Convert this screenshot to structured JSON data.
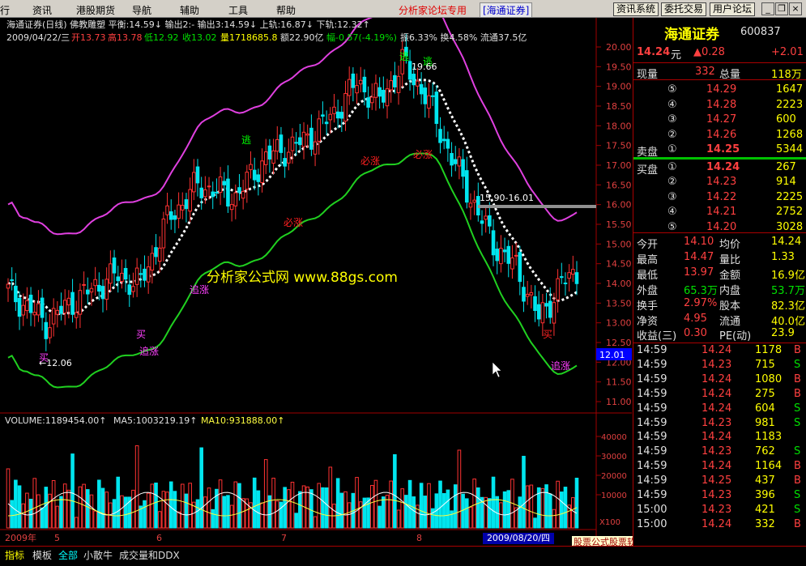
{
  "menu": {
    "items": [
      "行",
      "资讯",
      "港股期货",
      "导航",
      "辅助",
      "工具",
      "帮助"
    ],
    "title": "分析家论坛专用",
    "broker": "[海通证券]",
    "buttons": [
      "资讯系统",
      "委托交易",
      "用户论坛"
    ]
  },
  "stock": {
    "name": "海通证券",
    "code": "600837",
    "price": "14.24",
    "unit": "元",
    "change": "▲0.28",
    "pct": "+2.01"
  },
  "header": {
    "line1": "海通证券(日线) 佛教雕塑 平衡:14.59↓ 输出2:- 输出3:14.59↓ 上轨:16.87↓ 下轨:12.32↑",
    "line2_date": "2009/04/22/三",
    "line2_open": "开13.73",
    "line2_high": "高13.78",
    "line2_low": "低12.92",
    "line2_close": "收13.02",
    "line2_vol": "量1718685.8",
    "line2_amt": "额22.90亿",
    "line2_chg": "幅-0.57(-4.19%)",
    "line2_amp": "振6.33% 换4.58% 流通37.5亿"
  },
  "y_ticks": [
    "20.00",
    "19.50",
    "19.00",
    "18.50",
    "18.00",
    "17.50",
    "17.00",
    "16.50",
    "16.00",
    "15.50",
    "15.00",
    "14.50",
    "14.00",
    "13.50",
    "13.00",
    "12.50",
    "12.00",
    "11.50",
    "11.00"
  ],
  "price_marker": "12.01",
  "annotations": {
    "min_label": "←12.06",
    "max_label": "19.66",
    "range_label": "15.90-16.01",
    "watermark": "分析家公式网 www.88gs.com",
    "signals": [
      {
        "t": "逃",
        "c": "#00ff00"
      },
      {
        "t": "逃",
        "c": "#00ff00"
      },
      {
        "t": "逃",
        "c": "#00ff00"
      },
      {
        "t": "必涨",
        "c": "#ff2020"
      },
      {
        "t": "必涨",
        "c": "#ff2020"
      },
      {
        "t": "必涨",
        "c": "#ff2020"
      },
      {
        "t": "追涨",
        "c": "#ff40ff"
      },
      {
        "t": "追涨",
        "c": "#ff40ff"
      },
      {
        "t": "追涨",
        "c": "#ff40ff"
      },
      {
        "t": "买",
        "c": "#ff40ff"
      },
      {
        "t": "买",
        "c": "#ff40ff"
      },
      {
        "t": "买",
        "c": "#ff2020"
      }
    ]
  },
  "volume": {
    "label": "VOLUME:1189454.00↑",
    "ma5": "MA5:1003219.19↑",
    "ma10": "MA10:931888.00↑",
    "ticks": [
      "40000",
      "30000",
      "20000",
      "10000"
    ],
    "unit": "X100"
  },
  "x_labels": [
    "2009年",
    "5",
    "6",
    "7",
    "8"
  ],
  "date_cursor": "2009/08/20/四",
  "quote": {
    "xl_label": "现量",
    "xl": "332",
    "zl_label": "总量",
    "zl": "118万",
    "asks": [
      [
        "⑤",
        "14.29",
        "1647"
      ],
      [
        "④",
        "14.28",
        "2223"
      ],
      [
        "③",
        "14.27",
        "600"
      ],
      [
        "②",
        "14.26",
        "1268"
      ],
      [
        "①",
        "14.25",
        "5344"
      ]
    ],
    "ask_label": "卖盘",
    "bid_label": "买盘",
    "bids": [
      [
        "①",
        "14.24",
        "267"
      ],
      [
        "②",
        "14.23",
        "914"
      ],
      [
        "③",
        "14.22",
        "2225"
      ],
      [
        "④",
        "14.21",
        "2752"
      ],
      [
        "⑤",
        "14.20",
        "3028"
      ]
    ],
    "stats": [
      [
        "今开",
        "14.10",
        "均价",
        "14.24"
      ],
      [
        "最高",
        "14.47",
        "量比",
        "1.33"
      ],
      [
        "最低",
        "13.97",
        "金额",
        "16.9亿"
      ],
      [
        "外盘",
        "65.3万",
        "内盘",
        "53.7万"
      ],
      [
        "换手",
        "2.97%",
        "股本",
        "82.3亿"
      ],
      [
        "净资",
        "4.95",
        "流通",
        "40.0亿"
      ],
      [
        "收益(三)",
        "0.30",
        "PE(动)",
        "23.9"
      ]
    ]
  },
  "ticks": [
    [
      "14:59",
      "14.24",
      "1178",
      "B"
    ],
    [
      "14:59",
      "14.23",
      "715",
      "S"
    ],
    [
      "14:59",
      "14.24",
      "1080",
      "B"
    ],
    [
      "14:59",
      "14.24",
      "275",
      "B"
    ],
    [
      "14:59",
      "14.24",
      "604",
      "S"
    ],
    [
      "14:59",
      "14.23",
      "981",
      "S"
    ],
    [
      "14:59",
      "14.24",
      "1183",
      ""
    ],
    [
      "14:59",
      "14.23",
      "762",
      "S"
    ],
    [
      "14:59",
      "14.24",
      "1164",
      "B"
    ],
    [
      "14:59",
      "14.25",
      "437",
      "B"
    ],
    [
      "14:59",
      "14.23",
      "396",
      "S"
    ],
    [
      "15:00",
      "14.23",
      "421",
      "S"
    ],
    [
      "15:00",
      "14.24",
      "332",
      "B"
    ]
  ],
  "tabs": [
    "指标",
    "模板",
    "全部",
    "小散牛",
    "成交量和DDX"
  ],
  "footlink": "股票公式股票软件下载[分析家公式网www.88gs.com]",
  "colors": {
    "up": "#ff3232",
    "down": "#00e5ee",
    "upper_band": "#e040e0",
    "lower_band": "#20d020",
    "ma": "#ffffff"
  }
}
